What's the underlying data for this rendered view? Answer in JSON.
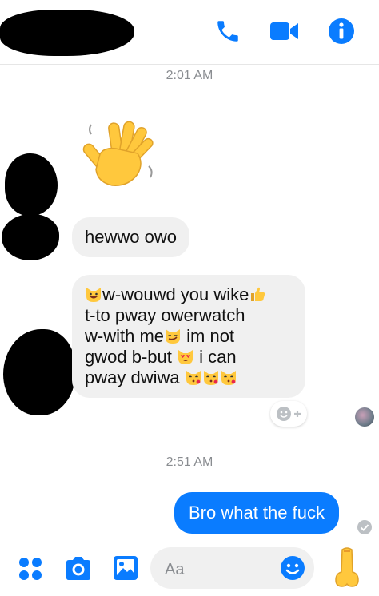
{
  "header": {
    "icons": [
      "phone-icon",
      "video-call-icon",
      "info-icon"
    ]
  },
  "colors": {
    "accent": "#0a7cff",
    "bubble_in": "#f0f0f0",
    "timestamp": "#8a8d91"
  },
  "thread": {
    "timestamp_1": "2:01 AM",
    "wave_emoji": "waving-hand",
    "msg_1": "hewwo owo",
    "msg_2_parts": {
      "l1": "w-wouwd you wike",
      "l2": "t-to pway owerwatch",
      "l3a": "w-with me",
      "l3b": " im not",
      "l4a": "gwod b-but ",
      "l4b": " i can",
      "l5": "pway dwiwa "
    },
    "timestamp_2": "2:51 AM",
    "msg_3": "Bro what the fuck"
  },
  "composer": {
    "placeholder": "Aa"
  }
}
